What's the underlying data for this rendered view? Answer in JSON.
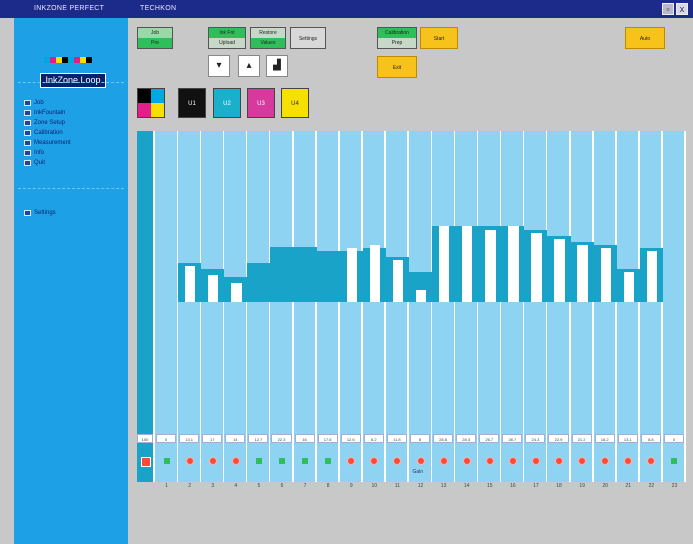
{
  "window": {
    "title_left": "INKZONE PERFECT",
    "title_right": "TECHKON",
    "close_label": "x"
  },
  "sidebar": {
    "logo_text": "InkZone Loop",
    "logo_colors": [
      "#00a8e0",
      "#e01e8c",
      "#f5e000",
      "#000000"
    ],
    "items": [
      {
        "label": "Job",
        "icon": "folder-icon"
      },
      {
        "label": "InkFountain",
        "icon": "fountain-icon"
      },
      {
        "label": "Zone Setup",
        "icon": "zone-icon"
      },
      {
        "label": "Calibration",
        "icon": "calibration-icon"
      },
      {
        "label": "Measurement",
        "icon": "measure-icon"
      },
      {
        "label": "Info",
        "icon": "info-icon"
      },
      {
        "label": "Quit",
        "icon": "quit-icon"
      }
    ],
    "settings_label": "Settings"
  },
  "toolbar": {
    "btn1_top": "Job",
    "btn1_bot": "Pre",
    "btn2_top": "Ink Fnt",
    "btn2_bot": "Upload",
    "btn3_top": "Restore",
    "btn3_bot": "Values",
    "btn4_label": "Settings",
    "btn5_top": "Calibration",
    "btn5_bot": "Prep",
    "btn_yellow1": "Start",
    "btn_yellow2": "Auto",
    "btn_yellow3": "Exit"
  },
  "ink_swatches": [
    {
      "label": "",
      "color": "#00a8e0"
    },
    {
      "label": "U1",
      "color": "#111111"
    },
    {
      "label": "U2",
      "color": "#1ab0cc"
    },
    {
      "label": "U3",
      "color": "#d63a9c"
    },
    {
      "label": "U4",
      "color": "#f5e000"
    }
  ],
  "zones": {
    "first_value": "100",
    "values": [
      "0",
      "13.1",
      "17",
      "14",
      "12.7",
      "22.3",
      "16",
      "17.6",
      "12.6",
      "6.2",
      "11.8",
      "8",
      "28.8",
      "28.3",
      "26.7",
      "28.7",
      "24.3",
      "22.9",
      "21.2",
      "18.2",
      "13.1",
      "8.8",
      "0"
    ],
    "labels": [
      "1",
      "2",
      "3",
      "4",
      "5",
      "6",
      "7",
      "8",
      "9",
      "10",
      "11",
      "12",
      "13",
      "14",
      "15",
      "16",
      "17",
      "18",
      "19",
      "20",
      "21",
      "22",
      "23"
    ],
    "teal_heights": [
      0,
      26,
      22,
      17,
      26,
      37,
      37,
      34,
      34,
      36,
      30,
      20,
      51,
      51,
      51,
      51,
      48,
      44,
      40,
      38,
      22,
      36,
      0
    ],
    "white_heights": [
      0,
      24,
      18,
      13,
      0,
      0,
      0,
      0,
      36,
      38,
      28,
      8,
      51,
      51,
      48,
      51,
      46,
      42,
      38,
      36,
      20,
      34,
      0
    ],
    "dot_types": [
      "g",
      "r",
      "r",
      "r",
      "g",
      "g",
      "g",
      "g",
      "r",
      "r",
      "r",
      "r",
      "r",
      "r",
      "r",
      "r",
      "r",
      "r",
      "r",
      "r",
      "r",
      "r",
      "g"
    ],
    "footer_label": "Gain"
  },
  "colors": {
    "teal": "#1aa3c8",
    "green_dot": "#2fbf5a",
    "red_dot": "#ff4a3a"
  }
}
